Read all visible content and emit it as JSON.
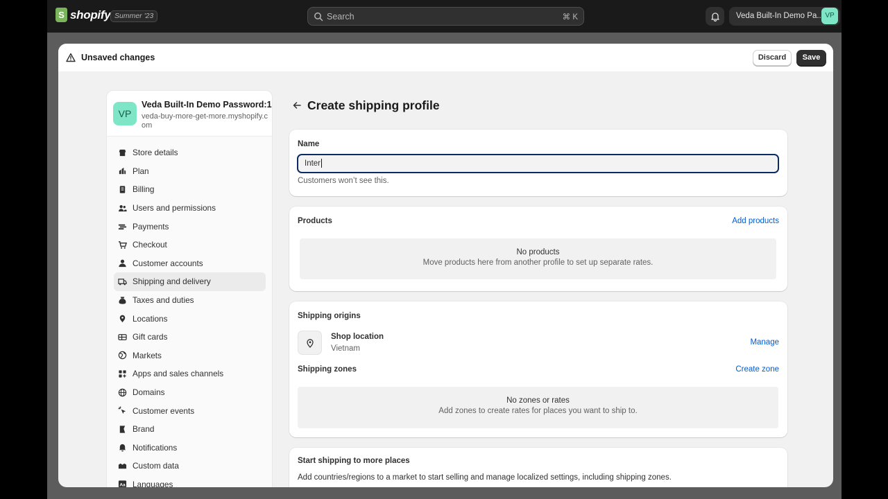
{
  "topbar": {
    "brand": "shopify",
    "edition": "Summer '23",
    "search_placeholder": "Search",
    "search_shortcut": "⌘ K",
    "store_name": "Veda Built-In Demo Pa...",
    "avatar_initials": "VP"
  },
  "modal": {
    "title": "Unsaved changes",
    "discard_label": "Discard",
    "save_label": "Save"
  },
  "sidebar": {
    "store_avatar": "VP",
    "store_name": "Veda Built-In Demo Password:1",
    "store_url": "veda-buy-more-get-more.myshopify.com",
    "items": [
      {
        "label": "Store details",
        "icon": "store-icon"
      },
      {
        "label": "Plan",
        "icon": "plan-icon"
      },
      {
        "label": "Billing",
        "icon": "billing-icon"
      },
      {
        "label": "Users and permissions",
        "icon": "users-icon"
      },
      {
        "label": "Payments",
        "icon": "payments-icon"
      },
      {
        "label": "Checkout",
        "icon": "cart-icon"
      },
      {
        "label": "Customer accounts",
        "icon": "person-icon"
      },
      {
        "label": "Shipping and delivery",
        "icon": "truck-icon",
        "active": true
      },
      {
        "label": "Taxes and duties",
        "icon": "tax-icon"
      },
      {
        "label": "Locations",
        "icon": "location-icon"
      },
      {
        "label": "Gift cards",
        "icon": "gift-card-icon"
      },
      {
        "label": "Markets",
        "icon": "globe-icon"
      },
      {
        "label": "Apps and sales channels",
        "icon": "apps-icon"
      },
      {
        "label": "Domains",
        "icon": "domain-icon"
      },
      {
        "label": "Customer events",
        "icon": "events-icon"
      },
      {
        "label": "Brand",
        "icon": "brand-icon"
      },
      {
        "label": "Notifications",
        "icon": "bell-icon"
      },
      {
        "label": "Custom data",
        "icon": "custom-data-icon"
      },
      {
        "label": "Languages",
        "icon": "language-icon"
      }
    ]
  },
  "page": {
    "title": "Create shipping profile"
  },
  "name_card": {
    "label": "Name",
    "value": "Inter",
    "help": "Customers won’t see this."
  },
  "products_card": {
    "title": "Products",
    "action": "Add products",
    "empty_title": "No products",
    "empty_desc": "Move products here from another profile to set up separate rates."
  },
  "origins_card": {
    "title": "Shipping origins",
    "location_name": "Shop location",
    "location_country": "Vietnam",
    "manage": "Manage",
    "zones_title": "Shipping zones",
    "create_zone": "Create zone",
    "empty_title": "No zones or rates",
    "empty_desc": "Add zones to create rates for places you want to ship to."
  },
  "more_card": {
    "title": "Start shipping to more places",
    "desc": "Add countries/regions to a market to start selling and manage localized settings, including shipping zones."
  },
  "colors": {
    "link": "#005bd3",
    "focus_border": "#0a2b63",
    "avatar_bg": "#7ee6c6",
    "brand_green": "#7ab55c"
  }
}
